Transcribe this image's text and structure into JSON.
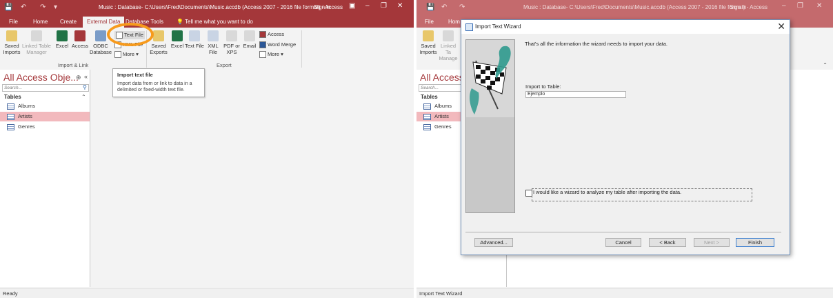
{
  "left": {
    "title_prefix": "Music : Database- C:\\Users\\Fred\\Documents\\Music.accdb (Access 2007 - 2016 file format) - Access",
    "sign_in": "Sign in",
    "tabs": [
      "File",
      "Home",
      "Create",
      "External Data",
      "Database Tools"
    ],
    "tell_me": "Tell me what you want to do",
    "ribbon": {
      "saved_imports": "Saved Imports",
      "linked_table_manager": "Linked Table Manager",
      "excel": "Excel",
      "access": "Access",
      "odbc": "ODBC Database",
      "text_file": "Text File",
      "xml_file": "XML File",
      "more": "More",
      "import_group": "Import & Link",
      "saved_exports": "Saved Exports",
      "export_excel": "Excel",
      "export_text": "Text File",
      "export_xml": "XML File",
      "pdf_xps": "PDF or XPS",
      "email": "Email",
      "export_access": "Access",
      "word_merge": "Word Merge",
      "export_more": "More",
      "export_group": "Export"
    },
    "nav": {
      "title": "All Access Obje...",
      "search": "Search...",
      "header": "Tables",
      "items": [
        "Albums",
        "Artists",
        "Genres"
      ]
    },
    "tooltip": {
      "title": "Import text file",
      "desc": "Import data from or link to data in a delimited or fixed-width text file."
    },
    "status": "Ready"
  },
  "right": {
    "title": "Music : Database- C:\\Users\\Fred\\Documents\\Music.accdb (Access 2007 - 2016 file format) - Access",
    "sign_in": "Sign in",
    "tabs": [
      "File",
      "Hom"
    ],
    "ribbon": {
      "saved_imports": "Saved Imports",
      "linked_table": "Linked Ta Manage"
    },
    "nav": {
      "title": "All Access",
      "search": "Search...",
      "header": "Tables",
      "items": [
        "Albums",
        "Artists",
        "Genres"
      ]
    },
    "dialog": {
      "title": "Import Text Wizard",
      "info": "That's all the information the wizard needs to import your data.",
      "import_to_label": "Import to Table:",
      "import_to_value": "Ejemplo",
      "checkbox_label": "I would like a wizard to analyze my table after importing the data.",
      "buttons": {
        "advanced": "Advanced...",
        "cancel": "Cancel",
        "back": "< Back",
        "next": "Next >",
        "finish": "Finish"
      }
    },
    "status": "Import Text Wizard"
  },
  "colors": {
    "accent": "#a4373a",
    "highlight": "#f79a1c",
    "selected": "#f2b9bd"
  }
}
